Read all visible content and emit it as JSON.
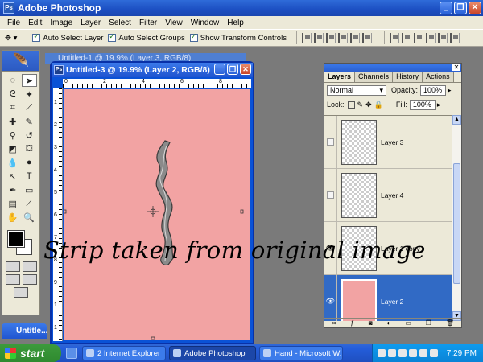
{
  "app": {
    "title": "Adobe Photoshop"
  },
  "window_controls": {
    "minimize": "_",
    "restore": "❐",
    "close": "✕"
  },
  "menu": [
    "File",
    "Edit",
    "Image",
    "Layer",
    "Select",
    "Filter",
    "View",
    "Window",
    "Help"
  ],
  "options": {
    "auto_select_layer": "Auto Select Layer",
    "auto_select_groups": "Auto Select Groups",
    "show_transform_controls": "Show Transform Controls"
  },
  "background_document": {
    "title": "Untitled-1 @ 19.9% (Layer 3, RGB/8)"
  },
  "document": {
    "title": "Untitled-3 @ 19.9% (Layer 2, RGB/8)",
    "canvas_color": "#f2a3a3",
    "ruler_top": [
      "0",
      "2",
      "4",
      "6",
      "8"
    ],
    "ruler_left": [
      "1",
      "2",
      "3",
      "4",
      "5",
      "6",
      "7",
      "8",
      "9",
      "1",
      "1"
    ]
  },
  "minimized_document": {
    "title": "Untitle..."
  },
  "layers_panel": {
    "tabs": [
      "Layers",
      "Channels",
      "History",
      "Actions"
    ],
    "blend_mode": "Normal",
    "opacity_label": "Opacity:",
    "opacity_value": "100%",
    "lock_label": "Lock:",
    "fill_label": "Fill:",
    "fill_value": "100%",
    "layers": [
      {
        "name": "Layer 3",
        "visible": false,
        "selected": false
      },
      {
        "name": "Layer 4",
        "visible": false,
        "selected": false
      },
      {
        "name": "Layer 1 copy",
        "visible": true,
        "selected": false
      },
      {
        "name": "Layer 2",
        "visible": true,
        "selected": true
      }
    ]
  },
  "caption": "Strip taken from original image",
  "taskbar": {
    "start": "start",
    "items": [
      {
        "label": "2 Internet Explorer",
        "active": false
      },
      {
        "label": "Adobe Photoshop",
        "active": true
      },
      {
        "label": "Hand - Microsoft W...",
        "active": false
      }
    ],
    "clock": "7:29 PM"
  }
}
